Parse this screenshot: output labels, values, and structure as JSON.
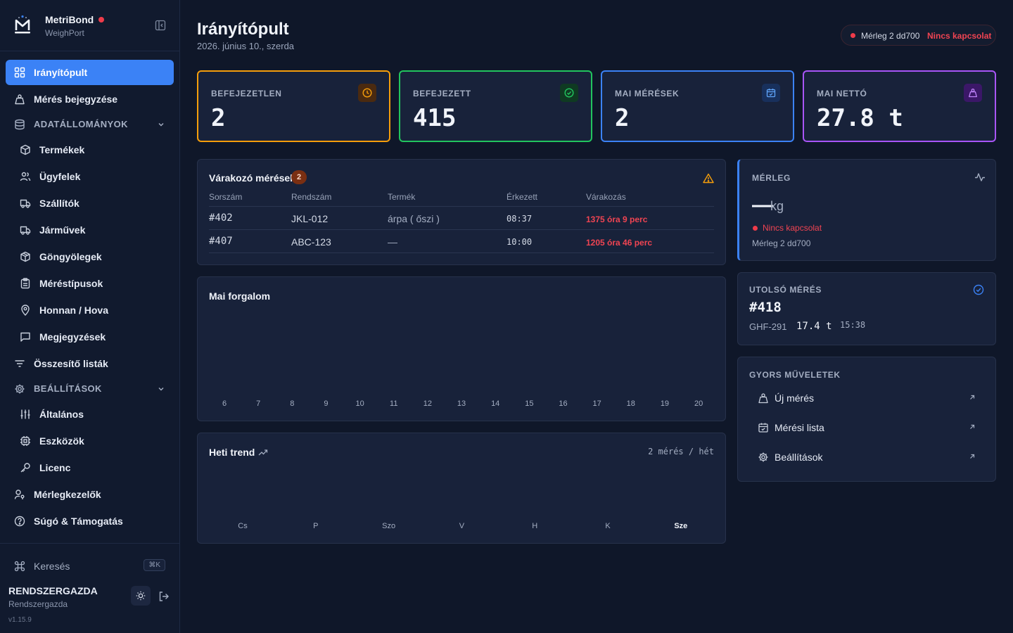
{
  "brand": {
    "name": "MetriBond",
    "subtitle": "WeighPort"
  },
  "sidebar": {
    "items": [
      {
        "label": "Irányítópult"
      },
      {
        "label": "Mérés bejegyzése"
      },
      {
        "label": "ADATÁLLOMÁNYOK"
      },
      {
        "label": "Termékek"
      },
      {
        "label": "Ügyfelek"
      },
      {
        "label": "Szállítók"
      },
      {
        "label": "Járművek"
      },
      {
        "label": "Göngyölegek"
      },
      {
        "label": "Méréstípusok"
      },
      {
        "label": "Honnan / Hova"
      },
      {
        "label": "Megjegyzések"
      },
      {
        "label": "Összesítő listák"
      },
      {
        "label": "BEÁLLÍTÁSOK"
      },
      {
        "label": "Általános"
      },
      {
        "label": "Eszközök"
      },
      {
        "label": "Licenc"
      },
      {
        "label": "Mérlegkezelők"
      },
      {
        "label": "Súgó & Támogatás"
      }
    ],
    "search_label": "Keresés",
    "search_shortcut": "⌘K",
    "user_name": "RENDSZERGAZDA",
    "user_role": "Rendszergazda",
    "version": "v1.15.9"
  },
  "header": {
    "title": "Irányítópult",
    "date": "2026. június 10., szerda",
    "connection": {
      "scale": "Mérleg 2 dd700",
      "status": "Nincs kapcsolat"
    }
  },
  "stats": [
    {
      "title": "BEFEJEZETLEN",
      "value": "2",
      "color": "#f59e0b"
    },
    {
      "title": "BEFEJEZETT",
      "value": "415",
      "color": "#22c55e"
    },
    {
      "title": "MAI MÉRÉSEK",
      "value": "2",
      "color": "#3b82f6"
    },
    {
      "title": "MAI NETTÓ",
      "value": "27.8 t",
      "color": "#a855f7"
    }
  ],
  "pending": {
    "title": "Várakozó mérések",
    "count": "2",
    "columns": [
      "Sorszám",
      "Rendszám",
      "Termék",
      "Érkezett",
      "Várakozás"
    ],
    "rows": [
      {
        "id": "#402",
        "plate": "JKL-012",
        "product": "árpa ( őszi )",
        "arrived": "08:37",
        "wait": "1375 óra 9 perc"
      },
      {
        "id": "#407",
        "plate": "ABC-123",
        "product": "—",
        "arrived": "10:00",
        "wait": "1205 óra 46 perc"
      }
    ]
  },
  "traffic": {
    "title": "Mai forgalom",
    "hours": [
      "6",
      "7",
      "8",
      "9",
      "10",
      "11",
      "12",
      "13",
      "14",
      "15",
      "16",
      "17",
      "18",
      "19",
      "20"
    ]
  },
  "weekly": {
    "title": "Heti trend",
    "summary": "2 mérés / hét",
    "days": [
      "Cs",
      "P",
      "Szo",
      "V",
      "H",
      "K",
      "Sze"
    ]
  },
  "scale": {
    "title": "MÉRLEG",
    "value": "—",
    "unit": "kg",
    "status": "Nincs kapcsolat",
    "name": "Mérleg 2 dd700"
  },
  "last": {
    "title": "UTOLSÓ MÉRÉS",
    "id": "#418",
    "plate": "GHF-291",
    "weight": "17.4 t",
    "time": "15:38"
  },
  "quick": {
    "title": "GYORS MŰVELETEK",
    "items": [
      {
        "label": "Új mérés"
      },
      {
        "label": "Mérési lista"
      },
      {
        "label": "Beállítások"
      }
    ]
  }
}
